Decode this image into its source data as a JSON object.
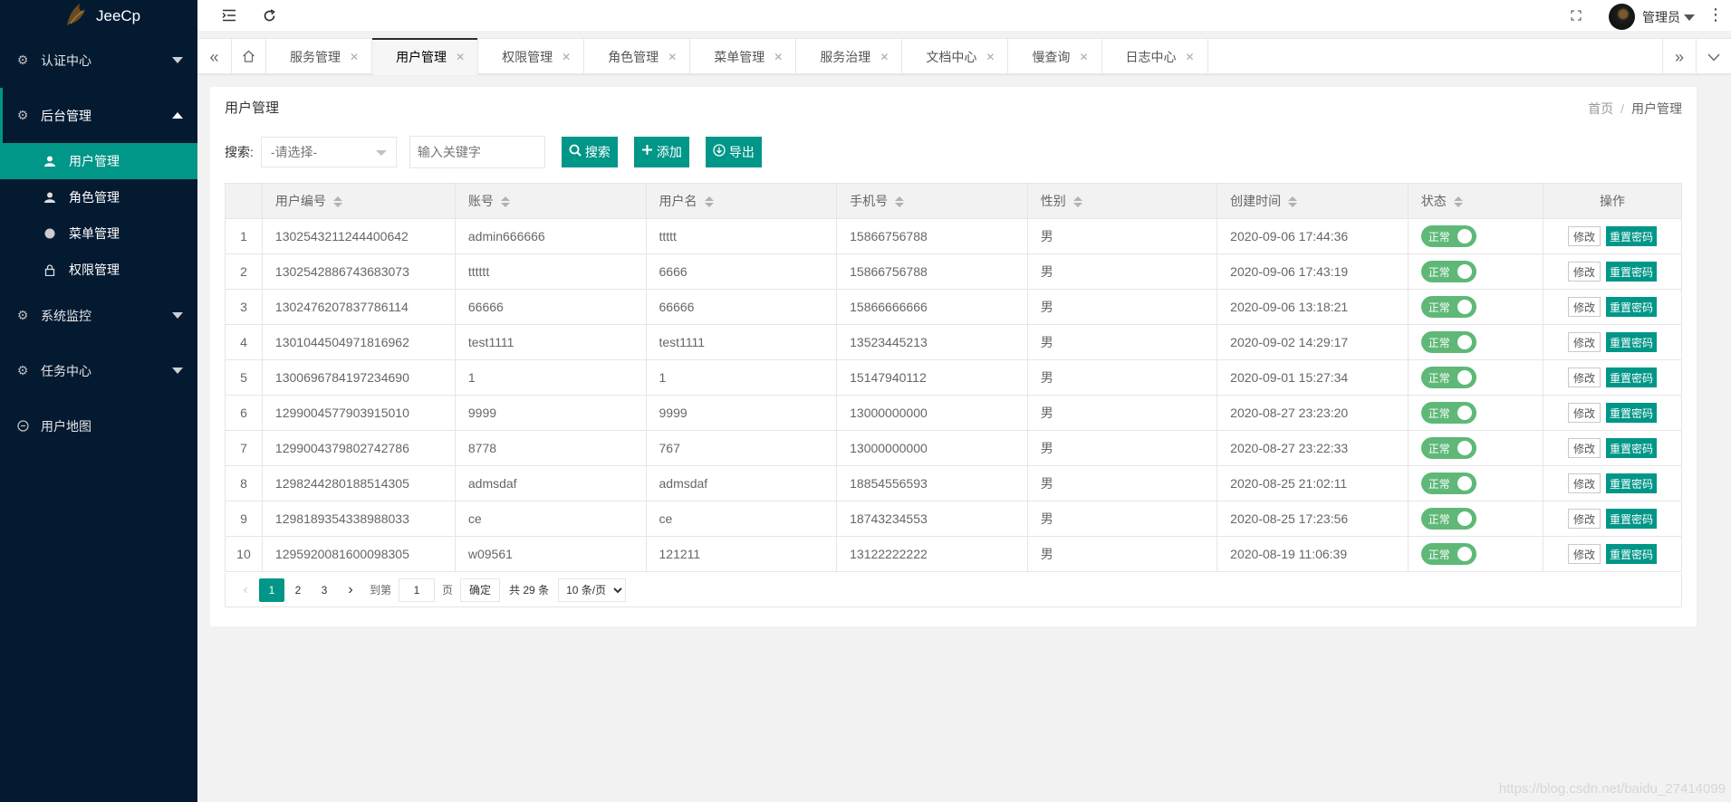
{
  "app": {
    "title": "JeeCp"
  },
  "sidebar": {
    "groups": [
      {
        "label": "认证中心",
        "icon": "gear-icon",
        "expanded": false
      },
      {
        "label": "后台管理",
        "icon": "gear-icon",
        "expanded": true,
        "items": [
          {
            "label": "用户管理",
            "icon": "user-icon",
            "selected": true
          },
          {
            "label": "角色管理",
            "icon": "user-icon",
            "selected": false
          },
          {
            "label": "菜单管理",
            "icon": "circle-icon",
            "selected": false
          },
          {
            "label": "权限管理",
            "icon": "lock-icon",
            "selected": false
          }
        ]
      },
      {
        "label": "系统监控",
        "icon": "gear-icon",
        "expanded": false
      },
      {
        "label": "任务中心",
        "icon": "gear-icon",
        "expanded": false
      },
      {
        "label": "用户地图",
        "icon": "map-icon",
        "expanded": false
      }
    ]
  },
  "header": {
    "user_name": "管理员"
  },
  "tabs": [
    {
      "label": "服务管理",
      "active": false
    },
    {
      "label": "用户管理",
      "active": true
    },
    {
      "label": "权限管理",
      "active": false
    },
    {
      "label": "角色管理",
      "active": false
    },
    {
      "label": "菜单管理",
      "active": false
    },
    {
      "label": "服务治理",
      "active": false
    },
    {
      "label": "文档中心",
      "active": false
    },
    {
      "label": "慢查询",
      "active": false
    },
    {
      "label": "日志中心",
      "active": false
    }
  ],
  "page": {
    "title": "用户管理",
    "breadcrumb": {
      "home": "首页",
      "separator": "/",
      "current": "用户管理"
    }
  },
  "search": {
    "label": "搜索:",
    "select_value": "-请选择-",
    "keyword_placeholder": "输入关键字",
    "search_button": "搜索",
    "add_button": "添加",
    "export_button": "导出"
  },
  "table": {
    "columns": [
      "用户编号",
      "账号",
      "用户名",
      "手机号",
      "性别",
      "创建时间",
      "状态",
      "操作"
    ],
    "status_label": "正常",
    "edit_label": "修改",
    "reset_label": "重置密码",
    "rows": [
      {
        "no": "1",
        "id": "1302543211244400642",
        "account": "admin666666",
        "name": "ttttt",
        "phone": "15866756788",
        "gender": "男",
        "created": "2020-09-06 17:44:36"
      },
      {
        "no": "2",
        "id": "1302542886743683073",
        "account": "tttttt",
        "name": "6666",
        "phone": "15866756788",
        "gender": "男",
        "created": "2020-09-06 17:43:19"
      },
      {
        "no": "3",
        "id": "1302476207837786114",
        "account": "66666",
        "name": "66666",
        "phone": "15866666666",
        "gender": "男",
        "created": "2020-09-06 13:18:21"
      },
      {
        "no": "4",
        "id": "1301044504971816962",
        "account": "test1111",
        "name": "test1111",
        "phone": "13523445213",
        "gender": "男",
        "created": "2020-09-02 14:29:17"
      },
      {
        "no": "5",
        "id": "1300696784197234690",
        "account": "1",
        "name": "1",
        "phone": "15147940112",
        "gender": "男",
        "created": "2020-09-01 15:27:34"
      },
      {
        "no": "6",
        "id": "1299004577903915010",
        "account": "9999",
        "name": "9999",
        "phone": "13000000000",
        "gender": "男",
        "created": "2020-08-27 23:23:20"
      },
      {
        "no": "7",
        "id": "1299004379802742786",
        "account": "8778",
        "name": "767",
        "phone": "13000000000",
        "gender": "男",
        "created": "2020-08-27 23:22:33"
      },
      {
        "no": "8",
        "id": "1298244280188514305",
        "account": "admsdaf",
        "name": "admsdaf",
        "phone": "18854556593",
        "gender": "男",
        "created": "2020-08-25 21:02:11"
      },
      {
        "no": "9",
        "id": "1298189354338988033",
        "account": "ce",
        "name": "ce",
        "phone": "18743234553",
        "gender": "男",
        "created": "2020-08-25 17:23:56"
      },
      {
        "no": "10",
        "id": "1295920081600098305",
        "account": "w09561",
        "name": "121211",
        "phone": "13122222222",
        "gender": "男",
        "created": "2020-08-19 11:06:39"
      }
    ]
  },
  "pagination": {
    "pages": [
      "1",
      "2",
      "3"
    ],
    "current": "1",
    "goto_label": "到第",
    "page_input": "1",
    "page_unit": "页",
    "confirm": "确定",
    "total": "共 29 条",
    "limit": "10 条/页"
  },
  "watermark": "https://blog.csdn.net/baidu_27414099",
  "colors": {
    "sidebar_bg": "#041a31",
    "accent": "#009688",
    "switch_on": "#5fb878"
  }
}
